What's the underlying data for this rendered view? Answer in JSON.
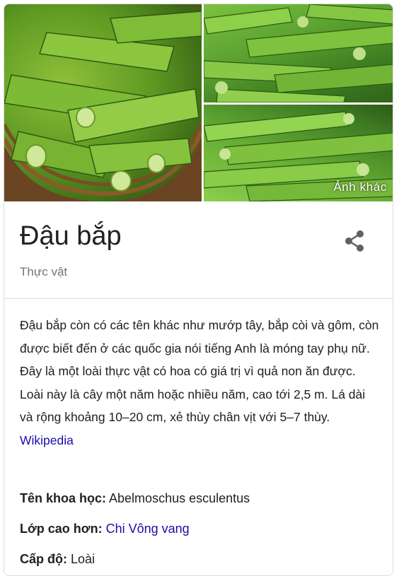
{
  "gallery": {
    "more_photos_label": "Ảnh khác"
  },
  "header": {
    "title": "Đậu bắp",
    "subtitle": "Thực vật",
    "share_icon": "share-icon"
  },
  "description": {
    "text": "Đậu bắp còn có các tên khác như mướp tây, bắp còi và gôm, còn được biết đến ở các quốc gia nói tiếng Anh là móng tay phụ nữ. Đây là một loài thực vật có hoa có giá trị vì quả non ăn được. Loài này là cây một năm hoặc nhiều năm, cao tới 2,5 m. Lá dài và rộng khoảng 10–20 cm, xẻ thùy chân vịt với 5–7 thùy.",
    "source_link": "Wikipedia"
  },
  "facts": [
    {
      "label": "Tên khoa học:",
      "value": "Abelmoschus esculentus",
      "is_link": false
    },
    {
      "label": "Lớp cao hơn:",
      "value": "Chi Vông vang",
      "is_link": true
    },
    {
      "label": "Cấp độ:",
      "value": "Loài",
      "is_link": false
    }
  ],
  "colors": {
    "link": "#1a0dab",
    "text": "#202124",
    "muted": "#70757a",
    "border": "#dadce0"
  }
}
